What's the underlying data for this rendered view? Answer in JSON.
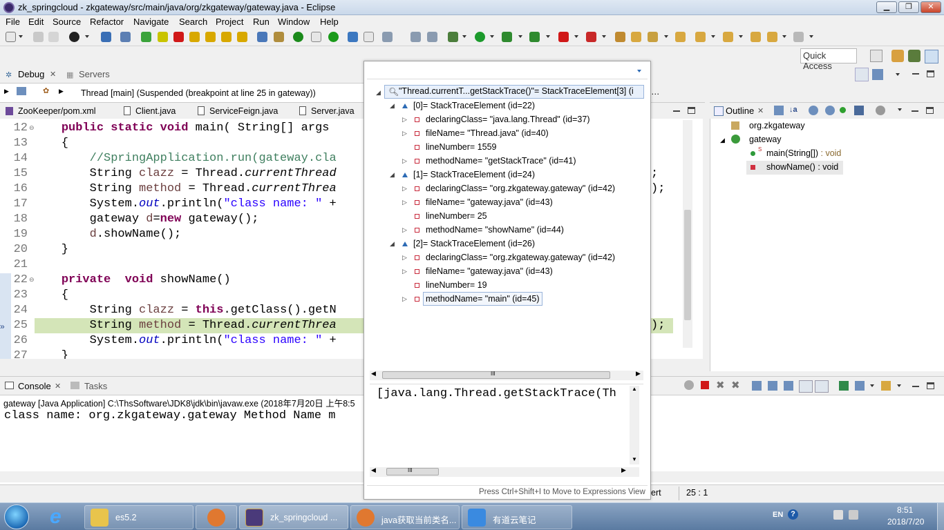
{
  "window": {
    "title": "zk_springcloud - zkgateway/src/main/java/org/zkgateway/gateway.java - Eclipse",
    "minimize": "▁",
    "maximize": "❐",
    "close": "✕"
  },
  "menu": [
    "File",
    "Edit",
    "Source",
    "Refactor",
    "Navigate",
    "Search",
    "Project",
    "Run",
    "Window",
    "Help"
  ],
  "quick_access": "Quick Access",
  "debug_view": {
    "tab_debug": "Debug",
    "tab_servers": "Servers",
    "thread_row": "Thread [main] (Suspended (breakpoint at line 25 in gateway))"
  },
  "editor_tabs": [
    "ZooKeeper/pom.xml",
    "Client.java",
    "ServiceFeign.java",
    "Server.java"
  ],
  "code": [
    {
      "n": "12",
      "text": "    public static void main( String[] args"
    },
    {
      "n": "13",
      "text": "    {"
    },
    {
      "n": "14",
      "text": "        //SpringApplication.run(gateway.cla"
    },
    {
      "n": "15",
      "text": "        String clazz = Thread.currentThread"
    },
    {
      "n": "16",
      "text": "        String method = Thread.currentThrea"
    },
    {
      "n": "17",
      "text": "        System.out.println(\"class name: \" +"
    },
    {
      "n": "18",
      "text": "        gateway d=new gateway();"
    },
    {
      "n": "19",
      "text": "        d.showName();"
    },
    {
      "n": "20",
      "text": "    }"
    },
    {
      "n": "21",
      "text": ""
    },
    {
      "n": "22",
      "text": "    private  void showName()"
    },
    {
      "n": "23",
      "text": "    {"
    },
    {
      "n": "24",
      "text": "        String clazz = this.getClass().getN"
    },
    {
      "n": "25",
      "text": "        String method = Thread.currentThrea"
    },
    {
      "n": "26",
      "text": "        System.out.println(\"class name: \" +"
    },
    {
      "n": "27",
      "text": "    }"
    }
  ],
  "code_tail": {
    "line15": ";",
    "line16": ");",
    "line25": ");"
  },
  "outline": {
    "tab": "Outline",
    "package": "org.zkgateway",
    "class": "gateway",
    "method_main": "main(String[])",
    "method_main_type": " : void",
    "method_main_modifier": "S",
    "method_show": "showName() : void"
  },
  "expression_popup": {
    "expression": "\"Thread.currentT...getStackTrace()\"= StackTraceElement[3]  (i",
    "tree": [
      {
        "depth": 1,
        "label": "[0]= StackTraceElement  (id=22)",
        "type": "element",
        "expanded": true
      },
      {
        "depth": 2,
        "label": "declaringClass= \"java.lang.Thread\" (id=37)",
        "type": "field",
        "expandable": true
      },
      {
        "depth": 2,
        "label": "fileName= \"Thread.java\" (id=40)",
        "type": "field",
        "expandable": true
      },
      {
        "depth": 2,
        "label": "lineNumber= 1559",
        "type": "field",
        "expandable": false
      },
      {
        "depth": 2,
        "label": "methodName= \"getStackTrace\" (id=41)",
        "type": "field",
        "expandable": true
      },
      {
        "depth": 1,
        "label": "[1]= StackTraceElement  (id=24)",
        "type": "element",
        "expanded": true
      },
      {
        "depth": 2,
        "label": "declaringClass= \"org.zkgateway.gateway\" (id=42)",
        "type": "field",
        "expandable": true
      },
      {
        "depth": 2,
        "label": "fileName= \"gateway.java\" (id=43)",
        "type": "field",
        "expandable": true
      },
      {
        "depth": 2,
        "label": "lineNumber= 25",
        "type": "field",
        "expandable": false
      },
      {
        "depth": 2,
        "label": "methodName= \"showName\" (id=44)",
        "type": "field",
        "expandable": true
      },
      {
        "depth": 1,
        "label": "[2]= StackTraceElement  (id=26)",
        "type": "element",
        "expanded": true
      },
      {
        "depth": 2,
        "label": "declaringClass= \"org.zkgateway.gateway\" (id=42)",
        "type": "field",
        "expandable": true
      },
      {
        "depth": 2,
        "label": "fileName= \"gateway.java\" (id=43)",
        "type": "field",
        "expandable": true
      },
      {
        "depth": 2,
        "label": "lineNumber= 19",
        "type": "field",
        "expandable": false
      },
      {
        "depth": 2,
        "label": "methodName= \"main\" (id=45)",
        "type": "field",
        "expandable": true,
        "selected": true
      }
    ],
    "detail_text": "[java.lang.Thread.getStackTrace(Th",
    "hint": "Press Ctrl+Shift+I to Move to Expressions View",
    "scroll_grip": "III"
  },
  "console": {
    "tab_console": "Console",
    "tab_tasks": "Tasks",
    "launch": "gateway [Java Application] C:\\ThsSoftware\\JDK8\\jdk\\bin\\javaw.exe (2018年7月20日 上午8:5",
    "output": "class name: org.zkgateway.gateway Method Name m"
  },
  "status": {
    "insert": "ert",
    "position": "25 : 1"
  },
  "taskbar": {
    "items": [
      "es5.2",
      "",
      "zk_springcloud ...",
      "java获取当前类名...",
      "有道云笔记"
    ],
    "lang": "EN",
    "help": "?",
    "time": "8:51",
    "date": "2018/7/20"
  },
  "colors": {
    "highlight_line": "#d4e5b8",
    "keyword": "#7f0055",
    "comment": "#3f7f5f",
    "string": "#2a00ff"
  }
}
